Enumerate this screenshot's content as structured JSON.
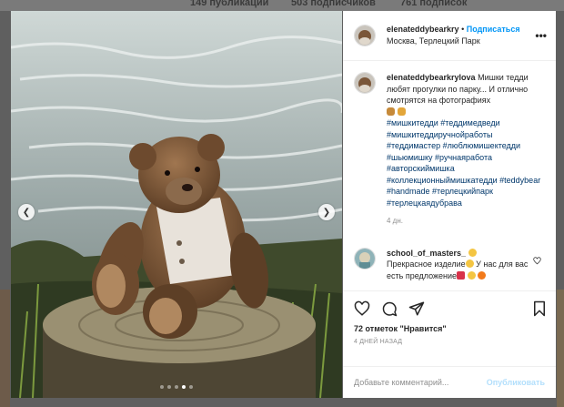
{
  "background": {
    "stats": [
      "149 публикаций",
      "503 подписчиков",
      "761 подписок"
    ]
  },
  "post": {
    "header": {
      "username": "elenateddybearkry",
      "follow_separator": "•",
      "follow_label": "Подписаться",
      "location": "Москва, Терлецкий Парк",
      "more_label": "•••"
    },
    "caption": {
      "username": "elenateddybearkrylova",
      "text": "Мишки тедди любят прогулки по парку... И отлично смотрятся на фотографиях",
      "hashtags": "#мишкитедди #теддимедведи #мишкитеддиручнойработы #теддимастер #люблюмишектедди #шьюмишку #ручнаяработа #авторскиймишка #коллекционныймишкатедди #teddybear #handmade #терлецкийпарк #терлецкаядубрава",
      "time": "4 дн."
    },
    "comment": {
      "username": "school_of_masters_",
      "text_1": "Прекрасное изделие",
      "text_2": "У нас для вас есть предложение"
    },
    "likes": "72 отметок \"Нравится\"",
    "posted_ago": "4 ДНЕЙ НАЗАД",
    "add_comment_placeholder": "Добавьте комментарий...",
    "publish_label": "Опубликовать",
    "carousel": {
      "slides": 5,
      "active_index": 3
    }
  },
  "colors": {
    "link_blue": "#0095f6",
    "hashtag": "#00376b",
    "muted": "#8e8e8e",
    "publish_disabled": "#b2dffc"
  },
  "icons": [
    "heart-icon",
    "comment-icon",
    "share-icon",
    "bookmark-icon",
    "more-icon",
    "chevron-left-icon",
    "chevron-right-icon"
  ]
}
